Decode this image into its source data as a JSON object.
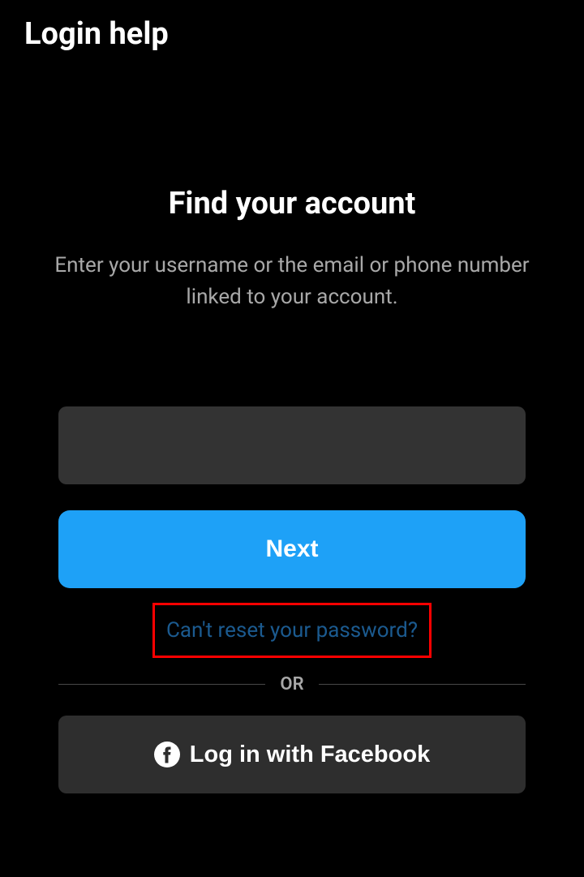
{
  "header": {
    "title": "Login help"
  },
  "main": {
    "heading": "Find your account",
    "subtitle": "Enter your username or the email or phone number linked to your account."
  },
  "form": {
    "input_value": "",
    "next_label": "Next",
    "reset_link": "Can't reset your password?"
  },
  "divider": {
    "text": "OR"
  },
  "facebook": {
    "label": "Log in with Facebook"
  }
}
